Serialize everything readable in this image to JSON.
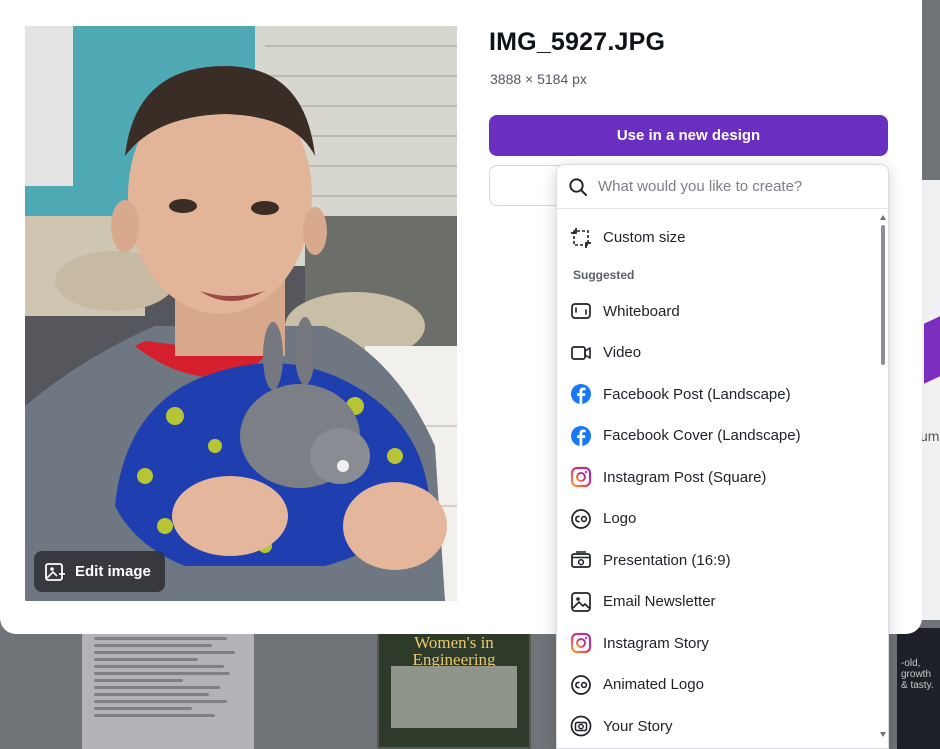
{
  "file": {
    "name": "IMG_5927.JPG",
    "dimensions": "3888 × 5184 px"
  },
  "photo": {
    "edit_label": "Edit image"
  },
  "actions": {
    "primary_label": "Use in a new design",
    "secondary_label": ""
  },
  "dropdown": {
    "search_placeholder": "What would you like to create?",
    "custom_size_label": "Custom size",
    "section_label": "Suggested",
    "items": [
      {
        "label": "Whiteboard",
        "icon": "whiteboard-icon"
      },
      {
        "label": "Video",
        "icon": "video-icon"
      },
      {
        "label": "Facebook Post (Landscape)",
        "icon": "facebook-icon"
      },
      {
        "label": "Facebook Cover (Landscape)",
        "icon": "facebook-icon"
      },
      {
        "label": "Instagram Post (Square)",
        "icon": "instagram-icon"
      },
      {
        "label": "Logo",
        "icon": "logo-icon"
      },
      {
        "label": "Presentation (16:9)",
        "icon": "presentation-icon"
      },
      {
        "label": "Email Newsletter",
        "icon": "image-icon"
      },
      {
        "label": "Instagram Story",
        "icon": "instagram-icon"
      },
      {
        "label": "Animated Logo",
        "icon": "logo-icon"
      },
      {
        "label": "Your Story",
        "icon": "camera-icon"
      }
    ]
  },
  "background": {
    "poster_text": "Women's in Engineering"
  },
  "colors": {
    "primary": "#6a2fc0",
    "facebook": "#1877f2",
    "instagram_pink": "#e1306c"
  }
}
